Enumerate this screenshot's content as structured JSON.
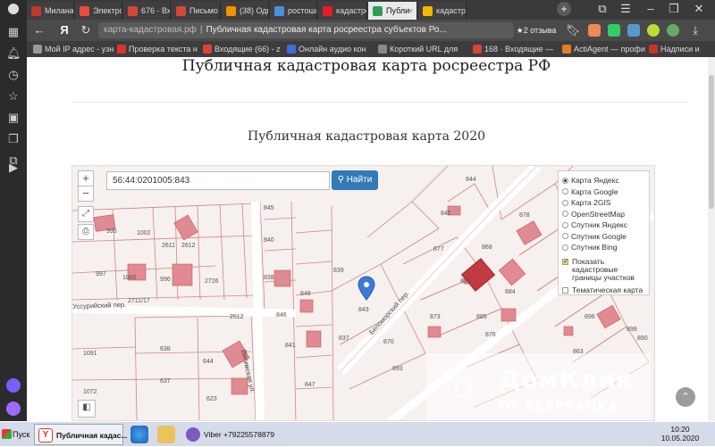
{
  "browser": {
    "tabs": [
      {
        "label": "Милана Н",
        "color": "#c0392b",
        "active": false
      },
      {
        "label": "Электрон",
        "color": "#e74c3c",
        "active": false
      },
      {
        "label": "676 · Вхо",
        "color": "#d44638",
        "active": false
      },
      {
        "label": "Письмо «",
        "color": "#d44638",
        "active": false
      },
      {
        "label": "(38) Одн",
        "color": "#f39200",
        "active": false
      },
      {
        "label": "ростоши",
        "color": "#4a90d9",
        "active": false
      },
      {
        "label": "кадастро",
        "color": "#e31e24",
        "active": false
      },
      {
        "label": "Публи",
        "color": "#2e9d55",
        "active": true
      },
      {
        "label": "кадастро",
        "color": "#f2b705",
        "active": false
      }
    ],
    "address": {
      "domain": "карта-кадастровая.рф",
      "title": "Публичная кадастровая карта росреестра субъектов Ро...",
      "reviews": "★2 отзыва"
    },
    "bookmarks": [
      {
        "label": "Мой IP адрес - узн",
        "color": "#999"
      },
      {
        "label": "Проверка текста н",
        "color": "#d33"
      },
      {
        "label": "Входящие (66) - z",
        "color": "#db4437"
      },
      {
        "label": "Онлайн аудио кон",
        "color": "#3b6fd6"
      },
      {
        "label": "Короткий URL для",
        "color": "#888"
      },
      {
        "label": "168 · Входящие —",
        "color": "#d44638"
      },
      {
        "label": "ActiAgent — профи",
        "color": "#e67e22"
      },
      {
        "label": "Надписи и",
        "color": "#c0392b"
      }
    ]
  },
  "page": {
    "title": "Публичная кадастровая карта росреестра РФ",
    "subtitle": "Публичная кадастровая карта 2020"
  },
  "map": {
    "zoom_in": "+",
    "zoom_out": "−",
    "search_value": "56:44:0201005:843",
    "find_button": "Найти",
    "layers": [
      {
        "label": "Карта Яндекс",
        "selected": true
      },
      {
        "label": "Карта Google",
        "selected": false
      },
      {
        "label": "Карта 2GIS",
        "selected": false
      },
      {
        "label": "OpenStreetMap",
        "selected": false
      },
      {
        "label": "Спутник Яндекс",
        "selected": false
      },
      {
        "label": "Спутник Google",
        "selected": false
      },
      {
        "label": "Спутник Bing",
        "selected": false
      }
    ],
    "checkboxes": [
      {
        "label": "Показать кадастровые границы участков",
        "checked": true
      },
      {
        "label": "Тематическая карта",
        "checked": false
      }
    ],
    "parcel_labels": [
      "995",
      "1002",
      "2611",
      "2612",
      "997",
      "1000",
      "996",
      "2726",
      "2711/17",
      "2512",
      "1091",
      "638",
      "644",
      "637",
      "623",
      "1072",
      "845",
      "840",
      "838",
      "848",
      "846",
      "841",
      "847",
      "839",
      "837",
      "843",
      "844",
      "842",
      "877",
      "868",
      "878",
      "875",
      "884",
      "885",
      "873",
      "876",
      "870",
      "893",
      "896",
      "899",
      "890",
      "863"
    ],
    "streets": [
      "Уссурийский пер.",
      "Витимская ул.",
      "Беломорский пер."
    ],
    "watermark": {
      "line1": "ДомКлик",
      "line2": "ОТ СБЕРБАНКА"
    }
  },
  "taskbar": {
    "start": "Пуск",
    "items": [
      {
        "label": "Публичная кадас...",
        "active": true
      },
      {
        "label": "Viber +79225578879",
        "active": false
      }
    ],
    "time": "10:20",
    "date": "10.05.2020"
  }
}
